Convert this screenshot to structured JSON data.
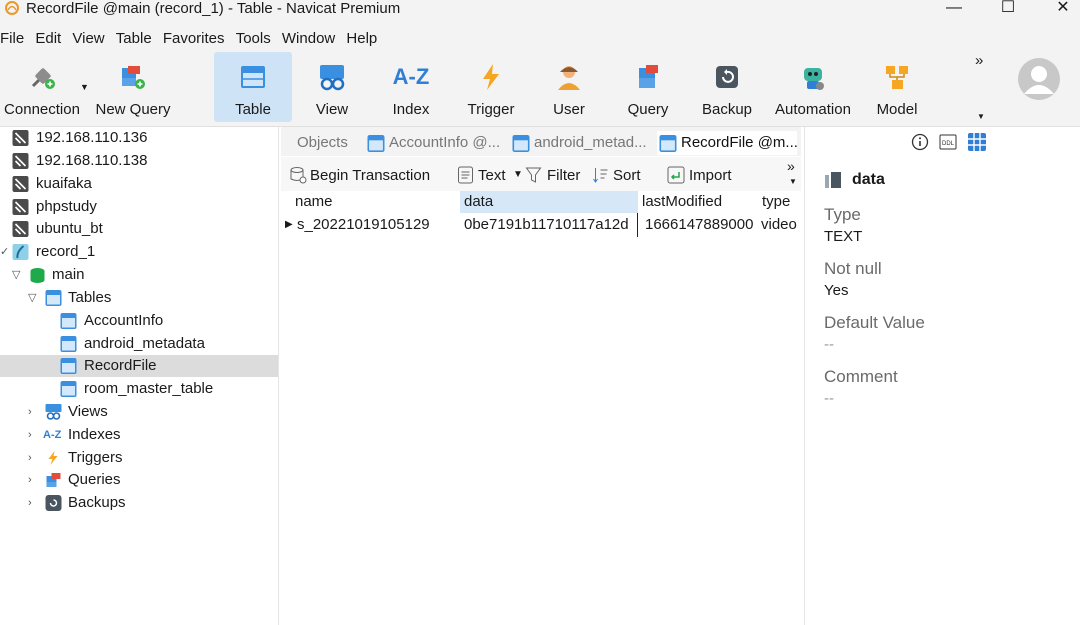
{
  "window": {
    "title": "RecordFile @main (record_1) - Table - Navicat Premium",
    "minimize": "—",
    "maximize": "☐",
    "close": "✕"
  },
  "menu": [
    "File",
    "Edit",
    "View",
    "Table",
    "Favorites",
    "Tools",
    "Window",
    "Help"
  ],
  "toolbar": {
    "connection": "Connection",
    "new_query": "New Query",
    "table": "Table",
    "view": "View",
    "index": "Index",
    "trigger": "Trigger",
    "user": "User",
    "query": "Query",
    "backup": "Backup",
    "automation": "Automation",
    "model": "Model",
    "more": "»"
  },
  "tree": {
    "c1": "192.168.110.136",
    "c2": "192.168.110.138",
    "c3": "kuaifaka",
    "c4": "phpstudy",
    "c5": "ubuntu_bt",
    "c6": "record_1",
    "db": "main",
    "tables": "Tables",
    "t1": "AccountInfo",
    "t2": "android_metadata",
    "t3": "RecordFile",
    "t4": "room_master_table",
    "views": "Views",
    "indexes": "Indexes",
    "triggers": "Triggers",
    "queries": "Queries",
    "backups": "Backups"
  },
  "tabs": {
    "objects": "Objects",
    "t1": "AccountInfo @...",
    "t2": "android_metad...",
    "t3": "RecordFile @m..."
  },
  "objtb": {
    "begin": "Begin Transaction",
    "text": "Text",
    "filter": "Filter",
    "sort": "Sort",
    "import": "Import",
    "more": "»"
  },
  "grid": {
    "columns": [
      "name",
      "data",
      "lastModified",
      "type"
    ],
    "rows": [
      [
        "s_20221019105129",
        "0be7191b11710117a12d",
        "1666147889000",
        "video"
      ]
    ]
  },
  "panel": {
    "field": "data",
    "type_label": "Type",
    "type_value": "TEXT",
    "notnull_label": "Not null",
    "notnull_value": "Yes",
    "default_label": "Default Value",
    "default_value": "--",
    "comment_label": "Comment",
    "comment_value": "--"
  },
  "colors": {
    "accent": "#2f7fd6",
    "selected_tab": "#cfe3f6",
    "table_icon": "#3a8fe0"
  }
}
